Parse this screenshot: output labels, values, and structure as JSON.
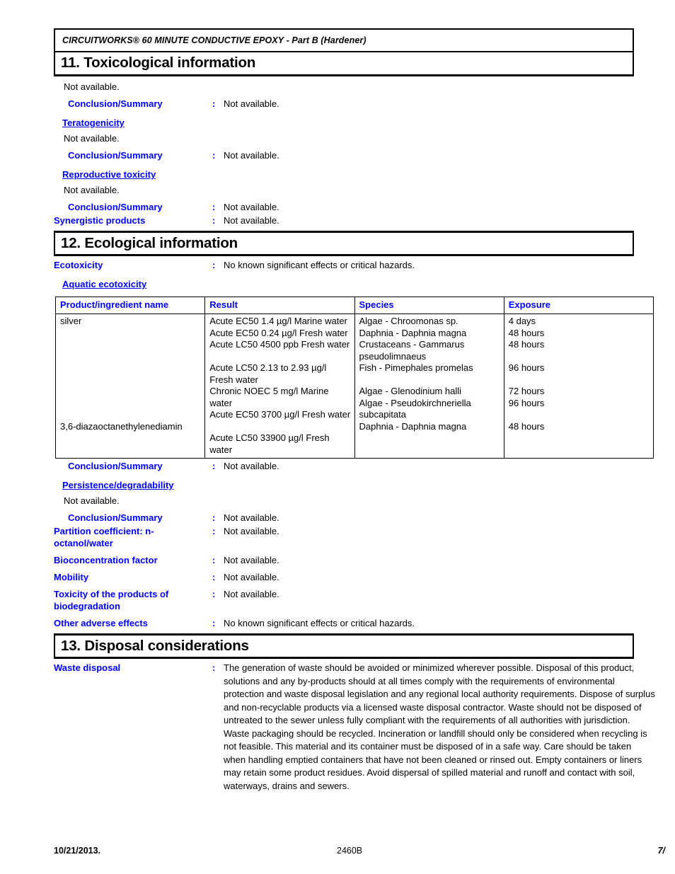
{
  "header": {
    "title": "CIRCUITWORKS® 60 MINUTE CONDUCTIVE EPOXY - Part B (Hardener)"
  },
  "colors": {
    "label_blue": "#0000FF",
    "text_black": "#000000"
  },
  "colon": ":",
  "sections": {
    "toxicological": {
      "heading": "11. Toxicological information",
      "intro": "Not available.",
      "conclusion_label_1": "Conclusion/Summary",
      "conclusion_value_1": "Not available.",
      "teratogenicity_label": "Teratogenicity",
      "teratogenicity_value": "Not available.",
      "conclusion_label_2": "Conclusion/Summary",
      "conclusion_value_2": "Not available.",
      "reproductive_label": "Reproductive toxicity",
      "reproductive_value": "Not available.",
      "conclusion_label_3": "Conclusion/Summary",
      "conclusion_value_3": "Not available.",
      "synergistic_label": "Synergistic products",
      "synergistic_value": "Not available."
    },
    "ecological": {
      "heading": "12. Ecological information",
      "ecotoxicity_label": "Ecotoxicity",
      "ecotoxicity_value": "No known significant effects or critical hazards.",
      "aquatic_label": "Aquatic ecotoxicity",
      "table": {
        "columns": [
          "Product/ingredient name",
          "Result",
          "Species",
          "Exposure"
        ],
        "rows": [
          {
            "name_top": "silver",
            "name_bottom": "3,6-diazaoctanethylenediamin",
            "result_lines": [
              "Acute EC50 1.4 µg/l Marine water",
              "Acute EC50 0.24 µg/l Fresh water",
              "Acute LC50 4500 ppb Fresh water",
              "",
              "Acute LC50 2.13 to 2.93 µg/l Fresh water",
              "Chronic NOEC 5 mg/l Marine water",
              "Acute EC50 3700 µg/l Fresh water",
              "",
              "Acute LC50 33900 µg/l Fresh water"
            ],
            "species_lines": [
              "Algae - Chroomonas sp.",
              "Daphnia - Daphnia magna",
              "Crustaceans - Gammarus pseudolimnaeus",
              "Fish - Pimephales promelas",
              "",
              "Algae - Glenodinium halli",
              "Algae - Pseudokirchneriella subcapitata",
              "Daphnia - Daphnia magna"
            ],
            "exposure_lines": [
              "4 days",
              "48 hours",
              "48 hours",
              "",
              "96 hours",
              "",
              "72 hours",
              "96 hours",
              "",
              "48 hours"
            ]
          }
        ]
      },
      "conclusion_label_1": "Conclusion/Summary",
      "conclusion_value_1": "Not available.",
      "persistence_label": "Persistence/degradability",
      "persistence_value": "Not available.",
      "conclusion_label_2": "Conclusion/Summary",
      "conclusion_value_2": "Not available.",
      "partition_label": "Partition coefficient: n-octanol/water",
      "partition_value": "Not available.",
      "bioconcentration_label": "Bioconcentration factor",
      "bioconcentration_value": "Not available.",
      "mobility_label": "Mobility",
      "mobility_value": "Not available.",
      "biodegradation_label": "Toxicity of the products of biodegradation",
      "biodegradation_value": "Not available.",
      "other_label": "Other adverse effects",
      "other_value": "No known significant effects or critical hazards."
    },
    "disposal": {
      "heading": "13. Disposal considerations",
      "waste_label": "Waste disposal",
      "waste_value": "The generation of waste should be avoided or minimized wherever possible.  Disposal of this product, solutions and any by-products should at all times comply with the requirements of environmental protection and waste disposal legislation and any regional local authority requirements.  Dispose of surplus and non-recyclable products via a licensed waste disposal contractor.  Waste should not be disposed of untreated to the sewer unless fully compliant with the requirements of all authorities with jurisdiction.  Waste packaging should be recycled.  Incineration or landfill should only be considered when recycling is not feasible.  This material and its container must be disposed of in a safe way.  Care should be taken when handling emptied containers that have not been cleaned or rinsed out.  Empty containers or liners may retain some product residues.  Avoid dispersal of spilled material and runoff and contact with soil, waterways, drains and sewers."
    }
  },
  "footer": {
    "date": "10/21/2013.",
    "code": "2460B",
    "page": "7/"
  }
}
